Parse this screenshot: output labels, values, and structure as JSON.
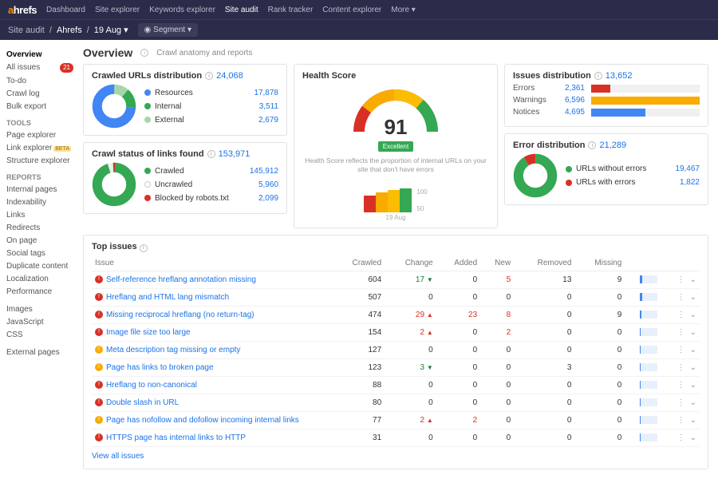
{
  "topnav": {
    "logo_a": "a",
    "logo_rest": "hrefs",
    "items": [
      "Dashboard",
      "Site explorer",
      "Keywords explorer",
      "Site audit",
      "Rank tracker",
      "Content explorer",
      "More ▾"
    ],
    "active_index": 3
  },
  "breadcrumb": {
    "root": "Site audit",
    "project": "Ahrefs",
    "date": "19 Aug ▾",
    "segment_label": "◉ Segment ▾"
  },
  "sidebar": {
    "top": [
      {
        "label": "Overview",
        "active": true
      },
      {
        "label": "All issues",
        "badge": "21"
      },
      {
        "label": "To-do"
      },
      {
        "label": "Crawl log"
      },
      {
        "label": "Bulk export"
      }
    ],
    "tools_hdr": "TOOLS",
    "tools": [
      {
        "label": "Page explorer"
      },
      {
        "label": "Link explorer",
        "beta": "BETA"
      },
      {
        "label": "Structure explorer"
      }
    ],
    "reports_hdr": "REPORTS",
    "reports": [
      "Internal pages",
      "Indexability",
      "Links",
      "Redirects",
      "On page",
      "Social tags",
      "Duplicate content",
      "Localization",
      "Performance"
    ],
    "reports2": [
      "Images",
      "JavaScript",
      "CSS"
    ],
    "reports3": [
      "External pages"
    ]
  },
  "page": {
    "title": "Overview",
    "subtitle": "Crawl anatomy and reports"
  },
  "crawled_urls": {
    "title": "Crawled URLs distribution",
    "total": "24,068",
    "legend": [
      {
        "label": "Resources",
        "value": "17,878",
        "color": "#4285f4"
      },
      {
        "label": "Internal",
        "value": "3,511",
        "color": "#34a853"
      },
      {
        "label": "External",
        "value": "2,679",
        "color": "#a7d7a9"
      }
    ]
  },
  "crawl_status": {
    "title": "Crawl status of links found",
    "total": "153,971",
    "legend": [
      {
        "label": "Crawled",
        "value": "145,912",
        "color": "#34a853"
      },
      {
        "label": "Uncrawled",
        "value": "5,960",
        "color": "#fff",
        "border": "#ccc"
      },
      {
        "label": "Blocked by robots.txt",
        "value": "2,099",
        "color": "#d93025"
      }
    ]
  },
  "health": {
    "title": "Health Score",
    "score": "91",
    "badge": "Excellent",
    "desc": "Health Score reflects the proportion of internal URLs on your site that don't have errors",
    "axis_max": "100",
    "axis_min": "50",
    "date": "19 Aug"
  },
  "issues_dist": {
    "title": "Issues distribution",
    "total": "13,652",
    "rows": [
      {
        "label": "Errors",
        "value": "2,361",
        "color": "#d93025",
        "pct": 18
      },
      {
        "label": "Warnings",
        "value": "6,596",
        "color": "#f9ab00",
        "pct": 100
      },
      {
        "label": "Notices",
        "value": "4,695",
        "color": "#4285f4",
        "pct": 50
      }
    ]
  },
  "error_dist": {
    "title": "Error distribution",
    "total": "21,289",
    "legend": [
      {
        "label": "URLs without errors",
        "value": "19,467",
        "color": "#34a853"
      },
      {
        "label": "URLs with errors",
        "value": "1,822",
        "color": "#d93025"
      }
    ]
  },
  "top_issues": {
    "title": "Top issues",
    "cols": [
      "Issue",
      "Crawled",
      "Change",
      "Added",
      "New",
      "Removed",
      "Missing",
      "",
      ""
    ],
    "rows": [
      {
        "sev": "err",
        "name": "Self-reference hreflang annotation missing",
        "crawled": "604",
        "change": "17",
        "dir": "down",
        "added": "0",
        "new": "5",
        "removed": "13",
        "missing": "9",
        "bar": 12
      },
      {
        "sev": "err",
        "name": "Hreflang and HTML lang mismatch",
        "crawled": "507",
        "change": "0",
        "dir": "",
        "added": "0",
        "new": "0",
        "removed": "0",
        "missing": "0",
        "bar": 10
      },
      {
        "sev": "err",
        "name": "Missing reciprocal hreflang (no return-tag)",
        "crawled": "474",
        "change": "29",
        "dir": "up",
        "added": "23",
        "new": "8",
        "removed": "0",
        "missing": "9",
        "bar": 9
      },
      {
        "sev": "err",
        "name": "Image file size too large",
        "crawled": "154",
        "change": "2",
        "dir": "up",
        "added": "0",
        "new": "2",
        "removed": "0",
        "missing": "0",
        "bar": 5
      },
      {
        "sev": "warn",
        "name": "Meta description tag missing or empty",
        "crawled": "127",
        "change": "0",
        "dir": "",
        "added": "0",
        "new": "0",
        "removed": "0",
        "missing": "0",
        "bar": 4
      },
      {
        "sev": "warn",
        "name": "Page has links to broken page",
        "crawled": "123",
        "change": "3",
        "dir": "down",
        "added": "0",
        "new": "0",
        "removed": "3",
        "missing": "0",
        "bar": 4
      },
      {
        "sev": "err",
        "name": "Hreflang to non-canonical",
        "crawled": "88",
        "change": "0",
        "dir": "",
        "added": "0",
        "new": "0",
        "removed": "0",
        "missing": "0",
        "bar": 3
      },
      {
        "sev": "err",
        "name": "Double slash in URL",
        "crawled": "80",
        "change": "0",
        "dir": "",
        "added": "0",
        "new": "0",
        "removed": "0",
        "missing": "0",
        "bar": 3
      },
      {
        "sev": "warn",
        "name": "Page has nofollow and dofollow incoming internal links",
        "crawled": "77",
        "change": "2",
        "dir": "up",
        "added": "2",
        "new": "0",
        "removed": "0",
        "missing": "0",
        "bar": 3
      },
      {
        "sev": "err",
        "name": "HTTPS page has internal links to HTTP",
        "crawled": "31",
        "change": "0",
        "dir": "",
        "added": "0",
        "new": "0",
        "removed": "0",
        "missing": "0",
        "bar": 2
      }
    ],
    "view_all": "View all issues"
  }
}
